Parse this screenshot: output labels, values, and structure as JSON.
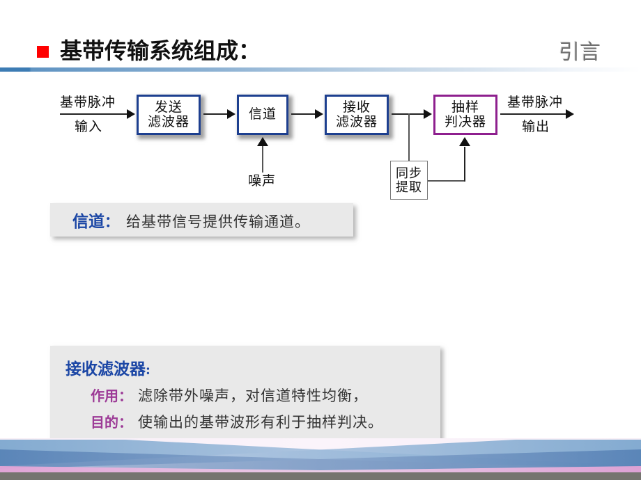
{
  "header": {
    "title": "基带传输系统组成：",
    "section_label": "引言",
    "bullet_color": "#ff0000",
    "rule_color": "#3d7cb4"
  },
  "diagram": {
    "input_label_top": "基带脉冲",
    "input_label_bottom": "输入",
    "output_label_top": "基带脉冲",
    "output_label_bottom": "输出",
    "noise_label": "噪声",
    "boxes": [
      {
        "id": "transmit-filter",
        "line1": "发送",
        "line2": "滤波器",
        "border_color": "#1d3f8f",
        "style": "blue-shadow"
      },
      {
        "id": "channel",
        "line1": "信道",
        "line2": "",
        "border_color": "#1d3f8f",
        "style": "blue-shadow"
      },
      {
        "id": "receive-filter",
        "line1": "接收",
        "line2": "滤波器",
        "border_color": "#1d3f8f",
        "style": "blue-shadow"
      },
      {
        "id": "sampler-decider",
        "line1": "抽样",
        "line2": "判决器",
        "border_color": "#8e1f8e",
        "style": "purple"
      },
      {
        "id": "sync-extract",
        "line1": "同步",
        "line2": "提取",
        "border_color": "#777777",
        "style": "plain"
      }
    ]
  },
  "callouts": {
    "channel": {
      "term": "信道",
      "colon": "：",
      "description": "给基带信号提供传输通道。",
      "term_color": "#1b46a5"
    },
    "receiver": {
      "heading": "接收滤波器",
      "heading_colon": ":",
      "heading_color": "#1b46a5",
      "key_color": "#9c3a96",
      "rows": [
        {
          "key": "作用",
          "colon": "：",
          "value": "滤除带外噪声，对信道特性均衡，"
        },
        {
          "key": "目的",
          "colon": "：",
          "value": "使输出的基带波形有利于抽样判决。"
        }
      ]
    }
  },
  "decoration": {
    "bottom_bar_color": "#75746f",
    "band_blue": "#6e9fc9",
    "band_blue_dark": "#4f7fb5",
    "band_pink": "#e3a6d6"
  }
}
